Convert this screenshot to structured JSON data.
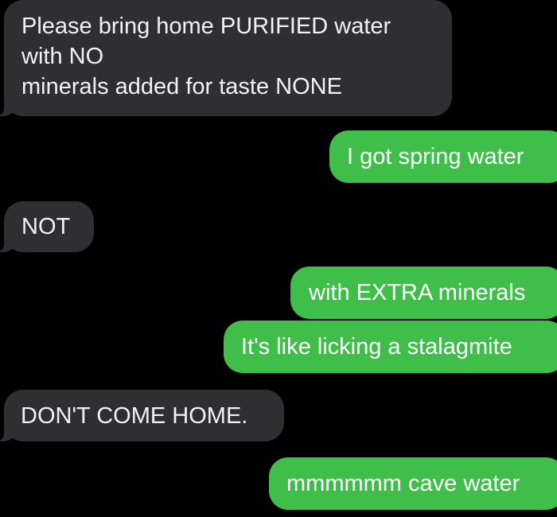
{
  "colors": {
    "background": "#000000",
    "incoming_bubble": "#2f2f31",
    "outgoing_bubble": "#3fbf4a",
    "incoming_text": "#f2f2f2",
    "outgoing_text": "#ffffff"
  },
  "messages": [
    {
      "direction": "incoming",
      "lines": [
        "Please bring home PURIFIED water",
        "with NO",
        "minerals added for taste NONE"
      ]
    },
    {
      "direction": "outgoing",
      "text": "I got spring water"
    },
    {
      "direction": "incoming",
      "text": "NOT"
    },
    {
      "direction": "outgoing",
      "text": "with EXTRA minerals"
    },
    {
      "direction": "outgoing",
      "text": "It's like licking a stalagmite"
    },
    {
      "direction": "incoming",
      "text": "DON'T COME HOME."
    },
    {
      "direction": "outgoing",
      "text": "mmmmmm cave water"
    }
  ]
}
